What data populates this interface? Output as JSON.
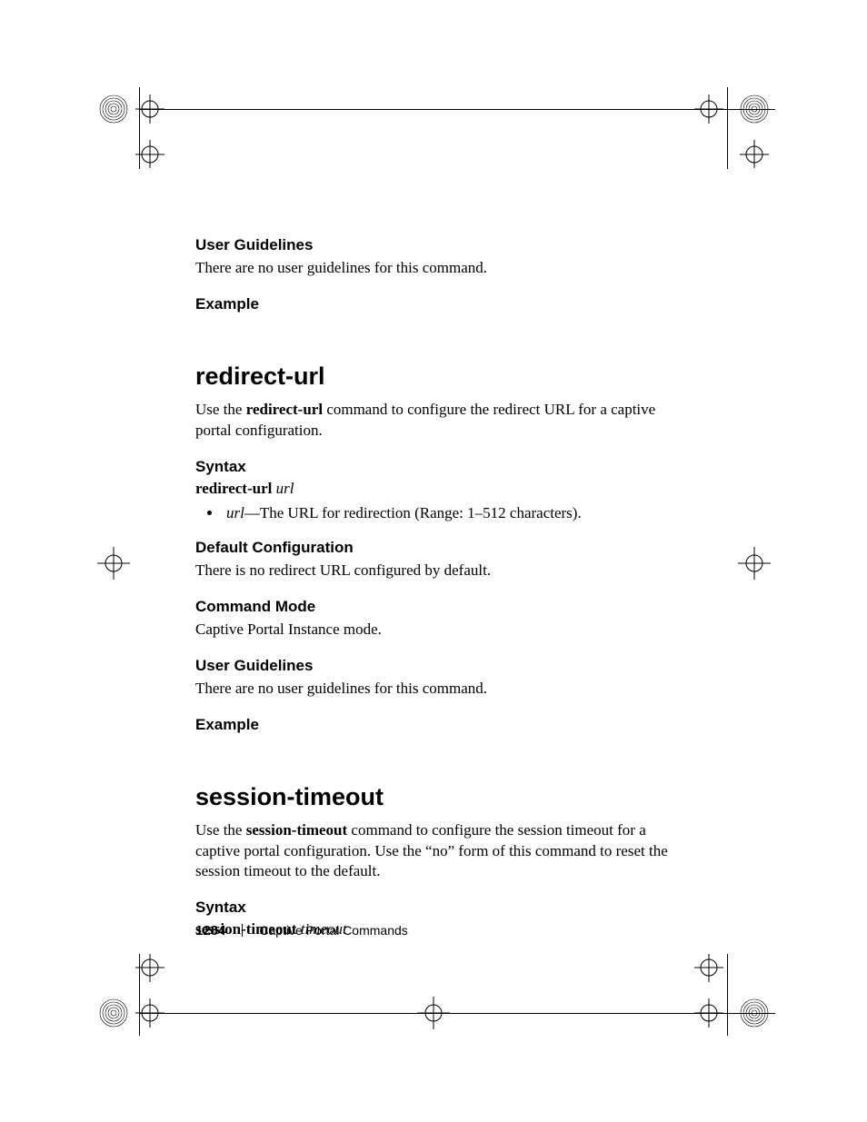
{
  "footer": {
    "page_number": "1284",
    "section": "Captive Portal Commands"
  },
  "blocks": {
    "ug1": {
      "heading": "User Guidelines",
      "text": "There are no user guidelines for this command."
    },
    "ex1": {
      "heading": "Example"
    },
    "redirect": {
      "title": "redirect-url",
      "desc_pre": "Use the ",
      "desc_cmd": "redirect-url",
      "desc_post": " command to configure the redirect URL for a captive portal configuration.",
      "syntax": {
        "heading": "Syntax",
        "cmd": "redirect-url",
        "arg": "url",
        "bullet_arg": "url",
        "bullet_rest": "—The URL for redirection (Range: 1–512 characters)."
      },
      "defcfg": {
        "heading": "Default Configuration",
        "text": "There is no redirect URL configured by default."
      },
      "mode": {
        "heading": "Command Mode",
        "text": "Captive Portal Instance mode."
      },
      "ug": {
        "heading": "User Guidelines",
        "text": "There are no user guidelines for this command."
      },
      "ex": {
        "heading": "Example"
      }
    },
    "session": {
      "title": "session-timeout",
      "desc_pre": "Use the ",
      "desc_cmd": "session-timeout",
      "desc_post": " command to configure the session timeout for a captive portal configuration. Use the “no” form of this command to reset the session timeout to the default.",
      "syntax": {
        "heading": "Syntax",
        "cmd": "session-timeout",
        "arg": "timeout"
      }
    }
  }
}
